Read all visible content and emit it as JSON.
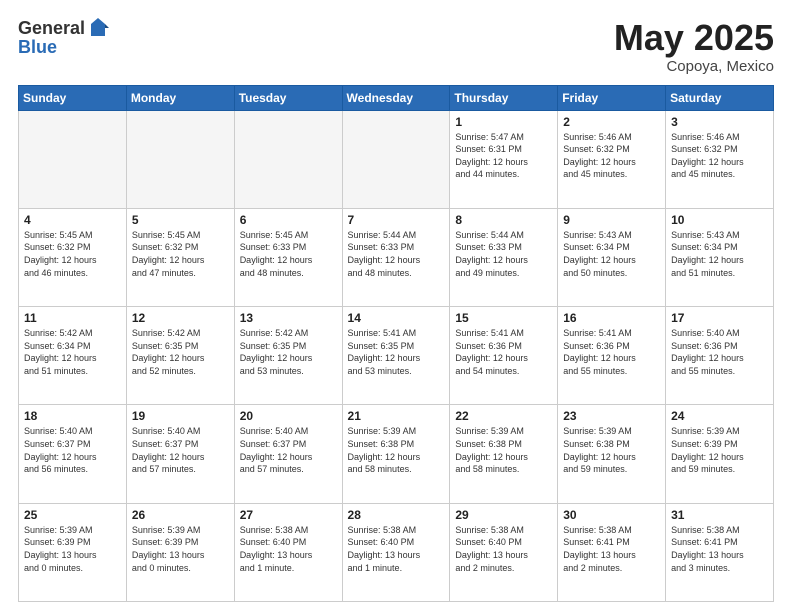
{
  "header": {
    "logo": {
      "line1": "General",
      "line2": "Blue"
    },
    "title": "May 2025",
    "location": "Copoya, Mexico"
  },
  "weekdays": [
    "Sunday",
    "Monday",
    "Tuesday",
    "Wednesday",
    "Thursday",
    "Friday",
    "Saturday"
  ],
  "weeks": [
    [
      {
        "day": "",
        "info": ""
      },
      {
        "day": "",
        "info": ""
      },
      {
        "day": "",
        "info": ""
      },
      {
        "day": "",
        "info": ""
      },
      {
        "day": "1",
        "info": "Sunrise: 5:47 AM\nSunset: 6:31 PM\nDaylight: 12 hours\nand 44 minutes."
      },
      {
        "day": "2",
        "info": "Sunrise: 5:46 AM\nSunset: 6:32 PM\nDaylight: 12 hours\nand 45 minutes."
      },
      {
        "day": "3",
        "info": "Sunrise: 5:46 AM\nSunset: 6:32 PM\nDaylight: 12 hours\nand 45 minutes."
      }
    ],
    [
      {
        "day": "4",
        "info": "Sunrise: 5:45 AM\nSunset: 6:32 PM\nDaylight: 12 hours\nand 46 minutes."
      },
      {
        "day": "5",
        "info": "Sunrise: 5:45 AM\nSunset: 6:32 PM\nDaylight: 12 hours\nand 47 minutes."
      },
      {
        "day": "6",
        "info": "Sunrise: 5:45 AM\nSunset: 6:33 PM\nDaylight: 12 hours\nand 48 minutes."
      },
      {
        "day": "7",
        "info": "Sunrise: 5:44 AM\nSunset: 6:33 PM\nDaylight: 12 hours\nand 48 minutes."
      },
      {
        "day": "8",
        "info": "Sunrise: 5:44 AM\nSunset: 6:33 PM\nDaylight: 12 hours\nand 49 minutes."
      },
      {
        "day": "9",
        "info": "Sunrise: 5:43 AM\nSunset: 6:34 PM\nDaylight: 12 hours\nand 50 minutes."
      },
      {
        "day": "10",
        "info": "Sunrise: 5:43 AM\nSunset: 6:34 PM\nDaylight: 12 hours\nand 51 minutes."
      }
    ],
    [
      {
        "day": "11",
        "info": "Sunrise: 5:42 AM\nSunset: 6:34 PM\nDaylight: 12 hours\nand 51 minutes."
      },
      {
        "day": "12",
        "info": "Sunrise: 5:42 AM\nSunset: 6:35 PM\nDaylight: 12 hours\nand 52 minutes."
      },
      {
        "day": "13",
        "info": "Sunrise: 5:42 AM\nSunset: 6:35 PM\nDaylight: 12 hours\nand 53 minutes."
      },
      {
        "day": "14",
        "info": "Sunrise: 5:41 AM\nSunset: 6:35 PM\nDaylight: 12 hours\nand 53 minutes."
      },
      {
        "day": "15",
        "info": "Sunrise: 5:41 AM\nSunset: 6:36 PM\nDaylight: 12 hours\nand 54 minutes."
      },
      {
        "day": "16",
        "info": "Sunrise: 5:41 AM\nSunset: 6:36 PM\nDaylight: 12 hours\nand 55 minutes."
      },
      {
        "day": "17",
        "info": "Sunrise: 5:40 AM\nSunset: 6:36 PM\nDaylight: 12 hours\nand 55 minutes."
      }
    ],
    [
      {
        "day": "18",
        "info": "Sunrise: 5:40 AM\nSunset: 6:37 PM\nDaylight: 12 hours\nand 56 minutes."
      },
      {
        "day": "19",
        "info": "Sunrise: 5:40 AM\nSunset: 6:37 PM\nDaylight: 12 hours\nand 57 minutes."
      },
      {
        "day": "20",
        "info": "Sunrise: 5:40 AM\nSunset: 6:37 PM\nDaylight: 12 hours\nand 57 minutes."
      },
      {
        "day": "21",
        "info": "Sunrise: 5:39 AM\nSunset: 6:38 PM\nDaylight: 12 hours\nand 58 minutes."
      },
      {
        "day": "22",
        "info": "Sunrise: 5:39 AM\nSunset: 6:38 PM\nDaylight: 12 hours\nand 58 minutes."
      },
      {
        "day": "23",
        "info": "Sunrise: 5:39 AM\nSunset: 6:38 PM\nDaylight: 12 hours\nand 59 minutes."
      },
      {
        "day": "24",
        "info": "Sunrise: 5:39 AM\nSunset: 6:39 PM\nDaylight: 12 hours\nand 59 minutes."
      }
    ],
    [
      {
        "day": "25",
        "info": "Sunrise: 5:39 AM\nSunset: 6:39 PM\nDaylight: 13 hours\nand 0 minutes."
      },
      {
        "day": "26",
        "info": "Sunrise: 5:39 AM\nSunset: 6:39 PM\nDaylight: 13 hours\nand 0 minutes."
      },
      {
        "day": "27",
        "info": "Sunrise: 5:38 AM\nSunset: 6:40 PM\nDaylight: 13 hours\nand 1 minute."
      },
      {
        "day": "28",
        "info": "Sunrise: 5:38 AM\nSunset: 6:40 PM\nDaylight: 13 hours\nand 1 minute."
      },
      {
        "day": "29",
        "info": "Sunrise: 5:38 AM\nSunset: 6:40 PM\nDaylight: 13 hours\nand 2 minutes."
      },
      {
        "day": "30",
        "info": "Sunrise: 5:38 AM\nSunset: 6:41 PM\nDaylight: 13 hours\nand 2 minutes."
      },
      {
        "day": "31",
        "info": "Sunrise: 5:38 AM\nSunset: 6:41 PM\nDaylight: 13 hours\nand 3 minutes."
      }
    ]
  ]
}
